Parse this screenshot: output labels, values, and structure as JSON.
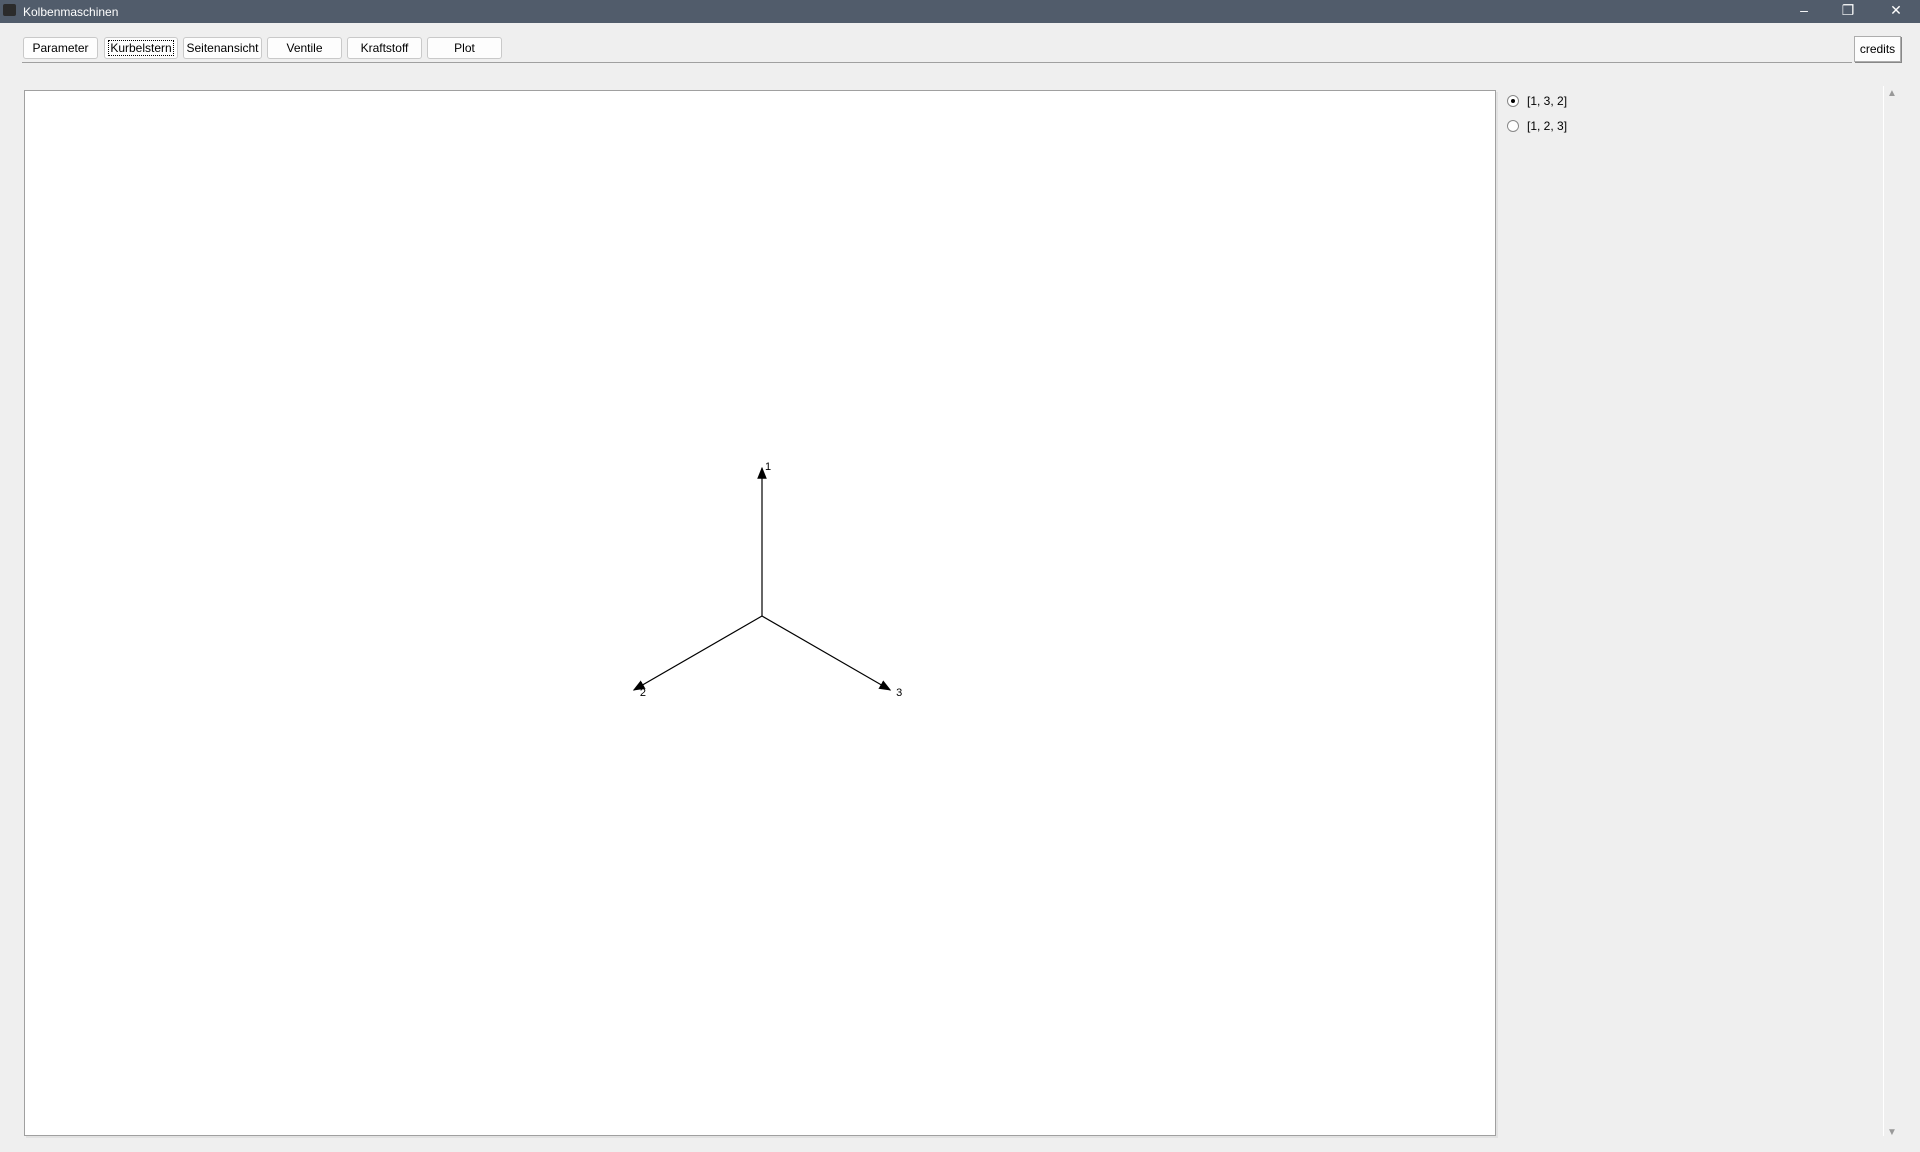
{
  "window": {
    "title": "Kolbenmaschinen"
  },
  "toolbar": {
    "tabs": [
      "Parameter",
      "Kurbelstern",
      "Seitenansicht",
      "Ventile",
      "Kraftstoff",
      "Plot"
    ],
    "active": "Kurbelstern",
    "credits": "credits"
  },
  "diagram": {
    "center_label": "",
    "arrows": [
      {
        "label": "1",
        "angle_deg": 90
      },
      {
        "label": "2",
        "angle_deg": 210
      },
      {
        "label": "3",
        "angle_deg": 330
      }
    ]
  },
  "options": {
    "items": [
      "[1, 3, 2]",
      "[1, 2, 3]"
    ],
    "selected": "[1, 3, 2]"
  }
}
